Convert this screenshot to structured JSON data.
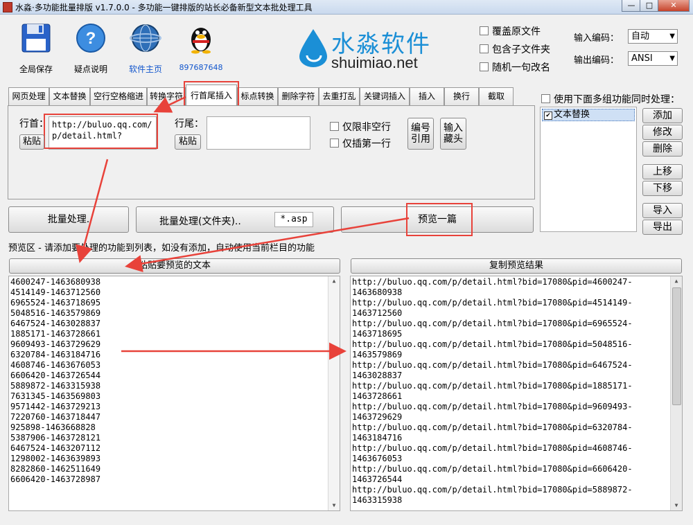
{
  "window": {
    "title": "水淼·多功能批量排版 v1.7.0.0 - 多功能一键排版的站长必备新型文本批处理工具",
    "btn_min": "—",
    "btn_max": "□",
    "btn_close": "✕"
  },
  "toolbar": [
    {
      "label": "全局保存",
      "icon": "floppy-disk-icon"
    },
    {
      "label": "疑点说明",
      "icon": "help-icon"
    },
    {
      "label": "软件主页",
      "icon": "globe-icon"
    },
    {
      "label": "897687648",
      "icon": "qq-penguin-icon"
    }
  ],
  "logo": {
    "brand": "水淼软件",
    "domain": "shuimiao.net"
  },
  "options": {
    "overwrite": "覆盖原文件",
    "subfolders": "包含子文件夹",
    "random_rename": "随机一句改名"
  },
  "encoding": {
    "input_label": "输入编码：",
    "input_value": "自动",
    "output_label": "输出编码：",
    "output_value": "ANSI"
  },
  "tabs": [
    "网页处理",
    "文本替换",
    "空行空格缩进",
    "转换字符",
    "行首尾插入",
    "标点转换",
    "删除字符",
    "去重打乱",
    "关键词插入",
    "插入",
    "换行",
    "截取"
  ],
  "active_tab": "行首尾插入",
  "panel": {
    "head_label": "行首：",
    "head_value": "http://buluo.qq.com/p/detail.html?",
    "paste1": "粘贴",
    "tail_label": "行尾：",
    "tail_value": "",
    "paste2": "粘贴",
    "only_nonempty": "仅限非空行",
    "only_first": "仅插第一行",
    "btn_number_ref": "编号\n引用",
    "btn_hide_head": "输入\n藏头"
  },
  "multi": {
    "label": "使用下面多组功能同时处理：",
    "items": [
      {
        "label": "文本替换",
        "checked": true
      }
    ],
    "add": "添加",
    "edit": "修改",
    "del": "删除",
    "up": "上移",
    "down": "下移",
    "import": "导入",
    "export": "导出"
  },
  "actions": {
    "batch": "批量处理.",
    "batch_folder": "批量处理(文件夹)..",
    "ext": "*.asp",
    "preview": "预览一篇"
  },
  "preview": {
    "hint": "预览区 - 请添加要处理的功能到列表，如没有添加，自动使用当前栏目的功能",
    "paste_btn": "粘贴要预览的文本",
    "copy_btn": "复制预览结果",
    "input_lines": [
      "4600247-1463680938",
      "4514149-1463712560",
      "6965524-1463718695",
      "5048516-1463579869",
      "6467524-1463028837",
      "1885171-1463728661",
      "9609493-1463729629",
      "6320784-1463184716",
      "4608746-1463676053",
      "6606420-1463726544",
      "5889872-1463315938",
      "7631345-1463569803",
      "9571442-1463729213",
      "7220760-1463718447",
      "925898-1463668828",
      "5387906-1463728121",
      "6467524-1463207112",
      "1298002-1463639893",
      "8282860-1462511649",
      "6606420-1463728987"
    ],
    "output_lines": [
      "http://buluo.qq.com/p/detail.html?bid=17080&pid=4600247-",
      "1463680938",
      "http://buluo.qq.com/p/detail.html?bid=17080&pid=4514149-",
      "1463712560",
      "http://buluo.qq.com/p/detail.html?bid=17080&pid=6965524-",
      "1463718695",
      "http://buluo.qq.com/p/detail.html?bid=17080&pid=5048516-",
      "1463579869",
      "http://buluo.qq.com/p/detail.html?bid=17080&pid=6467524-",
      "1463028837",
      "http://buluo.qq.com/p/detail.html?bid=17080&pid=1885171-",
      "1463728661",
      "http://buluo.qq.com/p/detail.html?bid=17080&pid=9609493-",
      "1463729629",
      "http://buluo.qq.com/p/detail.html?bid=17080&pid=6320784-",
      "1463184716",
      "http://buluo.qq.com/p/detail.html?bid=17080&pid=4608746-",
      "1463676053",
      "http://buluo.qq.com/p/detail.html?bid=17080&pid=6606420-",
      "1463726544",
      "http://buluo.qq.com/p/detail.html?bid=17080&pid=5889872-",
      "1463315938"
    ]
  },
  "colors": {
    "annotation_red": "#e8423a",
    "logo_blue": "#1b8fd6",
    "link_blue": "#1155cc"
  }
}
